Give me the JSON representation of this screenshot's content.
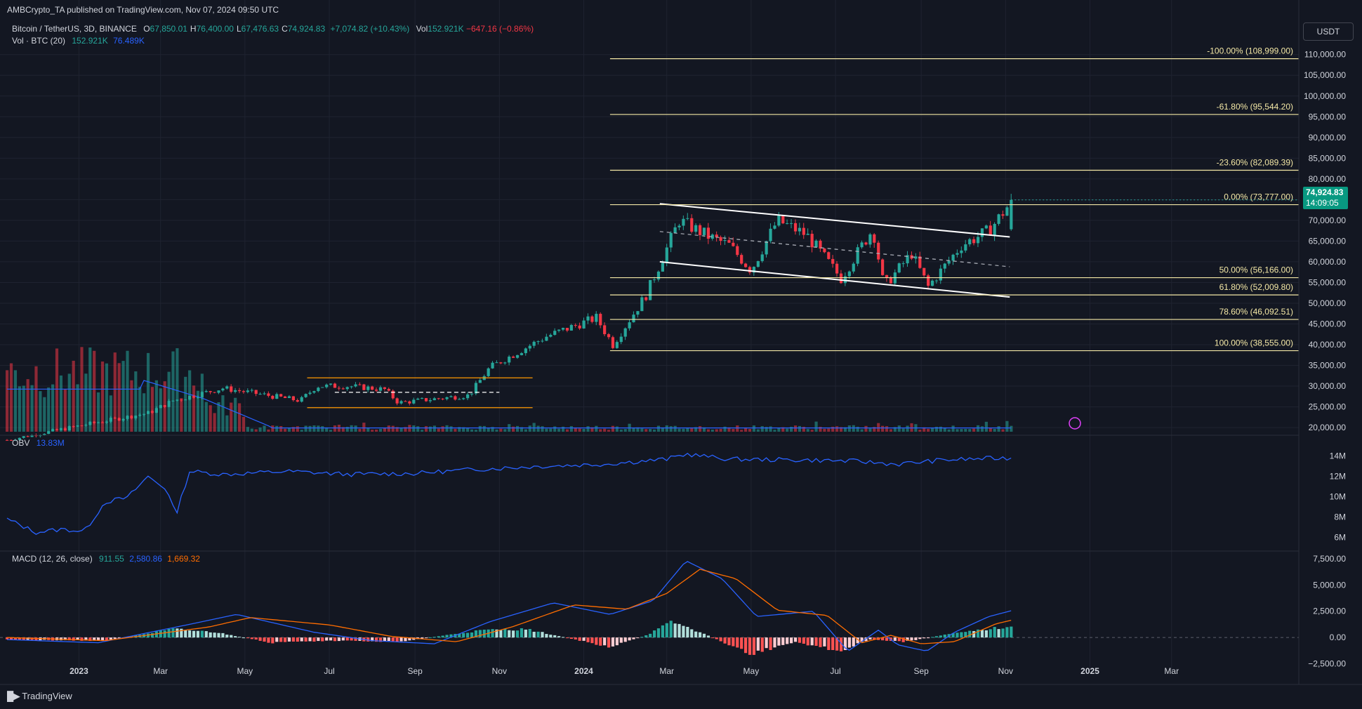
{
  "header": {
    "publisher_line": "AMBCrypto_TA published on TradingView.com, Nov 07, 2024 09:50 UTC",
    "symbol": "Bitcoin / TetherUS, 3D, BINANCE",
    "ohlc": [
      {
        "k": "O",
        "v": "67,850.01"
      },
      {
        "k": "H",
        "v": "76,400.00"
      },
      {
        "k": "L",
        "v": "67,476.63"
      },
      {
        "k": "C",
        "v": "74,924.83"
      }
    ],
    "change": "+7,074.82 (+10.43%)",
    "vol_label": "Vol",
    "vol_value": "152.921K",
    "vol_change": "−647.16 (−0.86%)",
    "vol_indicator_label": "Vol · BTC (20)",
    "vol_indicator_values": [
      "152.921K",
      "76.489K"
    ]
  },
  "currency_button": "USDT",
  "last_price": {
    "value": "74,924.83",
    "countdown": "14:09:05"
  },
  "watermark": "TradingView",
  "colors": {
    "background": "#131722",
    "up": "#26a69a",
    "down": "#f23645",
    "fib": "#f4e8a6",
    "range": "#ff9800",
    "obv": "#2962ff",
    "macd": "#2962ff",
    "signal": "#ff6d00",
    "grid": "#1f2330",
    "text": "#d1d4dc"
  },
  "chart_data": [
    {
      "type": "candlestick",
      "title": "Bitcoin / TetherUS, 3D, BINANCE",
      "ylim": [
        19000,
        113000
      ],
      "y_ticks": [
        "110,000.00",
        "105,000.00",
        "100,000.00",
        "95,000.00",
        "90,000.00",
        "85,000.00",
        "80,000.00",
        "75,000.00",
        "70,000.00",
        "65,000.00",
        "60,000.00",
        "55,000.00",
        "50,000.00",
        "45,000.00",
        "40,000.00",
        "35,000.00",
        "30,000.00",
        "25,000.00",
        "20,000.00"
      ],
      "x_ticks": [
        "2023",
        "Mar",
        "May",
        "Jul",
        "Sep",
        "Nov",
        "2024",
        "Mar",
        "May",
        "Jul",
        "Sep",
        "Nov",
        "2025",
        "Mar"
      ],
      "price_path_dates": [
        "2022-11-10",
        "2023-01-10",
        "2023-02-20",
        "2023-03-10",
        "2023-04-15",
        "2023-06-10",
        "2023-06-22",
        "2023-07-15",
        "2023-08-10",
        "2023-08-20",
        "2023-10-10",
        "2023-10-25",
        "2023-12-05",
        "2024-01-10",
        "2024-01-22",
        "2024-02-15",
        "2024-03-10",
        "2024-04-01",
        "2024-04-15",
        "2024-05-01",
        "2024-05-20",
        "2024-06-10",
        "2024-07-05",
        "2024-07-28",
        "2024-08-05",
        "2024-08-25",
        "2024-09-06",
        "2024-09-30",
        "2024-10-20",
        "2024-11-06"
      ],
      "price_path_values": [
        17000,
        21000,
        23500,
        26500,
        29500,
        26500,
        30000,
        30000,
        29200,
        26000,
        27800,
        34500,
        42000,
        46500,
        40000,
        52000,
        70000,
        66000,
        64000,
        58000,
        70000,
        66500,
        56000,
        68000,
        54000,
        62000,
        54000,
        64000,
        67500,
        74924.83
      ],
      "fib_levels": [
        {
          "label": "-100.00% (108,999.00)",
          "price": 108999
        },
        {
          "label": "-61.80% (95,544.20)",
          "price": 95544.2
        },
        {
          "label": "-23.60% (82,089.39)",
          "price": 82089.39
        },
        {
          "label": "0.00% (73,777.00)",
          "price": 73777
        },
        {
          "label": "50.00% (56,166.00)",
          "price": 56166
        },
        {
          "label": "61.80% (52,009.80)",
          "price": 52009.8
        },
        {
          "label": "78.60% (46,092.51)",
          "price": 46092.51
        },
        {
          "label": "100.00% (38,555.00)",
          "price": 38555
        }
      ],
      "fib_start_date": "2024-01-20",
      "range_box": {
        "start": "2023-06-15",
        "end": "2023-11-25",
        "top": 32000,
        "mid": 28500,
        "bottom": 24800
      },
      "channel": {
        "start": "2024-02-25",
        "end": "2024-11-04",
        "upper": [
          74000,
          66000
        ],
        "middle": [
          67300,
          58800
        ],
        "lower": [
          60000,
          51500
        ]
      }
    },
    {
      "type": "area",
      "title": "OBV",
      "legend_value": "13.83M",
      "ylim": [
        5000000,
        15500000
      ],
      "y_ticks": [
        "14M",
        "12M",
        "10M",
        "8M",
        "6M"
      ],
      "dates": [
        "2022-11-10",
        "2022-12-01",
        "2022-12-20",
        "2023-01-05",
        "2023-01-20",
        "2023-02-05",
        "2023-02-20",
        "2023-03-05",
        "2023-03-12",
        "2023-03-22",
        "2023-04-15",
        "2023-06-01",
        "2023-07-15",
        "2023-09-01",
        "2023-10-15",
        "2023-12-01",
        "2024-01-15",
        "2024-03-01",
        "2024-03-15",
        "2024-04-15",
        "2024-06-15",
        "2024-07-15",
        "2024-08-15",
        "2024-09-15",
        "2024-10-15",
        "2024-11-06"
      ],
      "values": [
        7800000,
        6500000,
        6800000,
        6600000,
        9500000,
        9900000,
        12000000,
        10800000,
        8200000,
        12500000,
        12200000,
        12500000,
        12200000,
        12300000,
        12700000,
        13000000,
        13200000,
        13700000,
        14200000,
        13700000,
        13600000,
        13500000,
        13200000,
        13600000,
        13750000,
        13830000
      ]
    },
    {
      "type": "line",
      "title": "MACD (12, 26, close)",
      "legend_values": [
        "911.55",
        "2,580.86",
        "1,669.32"
      ],
      "ylim": [
        -2800,
        7900
      ],
      "y_ticks": [
        "7,500.00",
        "5,000.00",
        "2,500.00",
        "0.00",
        "−2,500.00"
      ],
      "series": [
        {
          "dates": [
            "2022-11-10",
            "2023-01-15",
            "2023-03-20",
            "2023-04-25",
            "2023-06-20",
            "2023-08-01",
            "2023-09-15",
            "2023-10-25",
            "2023-12-10",
            "2024-01-20",
            "2024-02-20",
            "2024-03-15",
            "2024-04-10",
            "2024-05-05",
            "2024-06-15",
            "2024-07-10",
            "2024-08-01",
            "2024-08-15",
            "2024-09-05",
            "2024-09-25",
            "2024-10-20",
            "2024-11-06"
          ],
          "values": [
            -200,
            -500,
            1200,
            2200,
            500,
            -300,
            -600,
            1500,
            3300,
            2200,
            3500,
            7300,
            5600,
            2000,
            2500,
            -1300,
            700,
            -700,
            -1300,
            500,
            2000,
            2580.86
          ]
        },
        {
          "dates": [
            "2022-11-10",
            "2023-01-20",
            "2023-04-05",
            "2023-05-05",
            "2023-07-01",
            "2023-08-15",
            "2023-10-01",
            "2023-11-10",
            "2023-12-25",
            "2024-02-01",
            "2024-03-01",
            "2024-03-25",
            "2024-04-20",
            "2024-05-20",
            "2024-06-25",
            "2024-07-20",
            "2024-08-10",
            "2024-09-01",
            "2024-09-25",
            "2024-10-25",
            "2024-11-06"
          ],
          "values": [
            0,
            -300,
            1000,
            1900,
            1200,
            100,
            -400,
            1000,
            3100,
            2700,
            4200,
            6500,
            5600,
            2600,
            2100,
            -500,
            200,
            -600,
            -400,
            1300,
            1669.32
          ]
        }
      ],
      "histogram": {
        "dates": [
          "2022-11-10",
          "2023-01-20",
          "2023-03-10",
          "2023-04-10",
          "2023-05-20",
          "2023-07-10",
          "2023-08-20",
          "2023-10-20",
          "2023-11-20",
          "2024-01-20",
          "2024-02-15",
          "2024-03-05",
          "2024-03-25",
          "2024-05-01",
          "2024-06-01",
          "2024-07-05",
          "2024-07-25",
          "2024-08-20",
          "2024-09-20",
          "2024-10-25",
          "2024-11-06"
        ],
        "values": [
          -200,
          -300,
          800,
          500,
          -500,
          -300,
          -400,
          700,
          800,
          -900,
          200,
          1500,
          500,
          -1600,
          -400,
          -1300,
          -200,
          -400,
          300,
          900,
          911.55
        ]
      }
    }
  ]
}
